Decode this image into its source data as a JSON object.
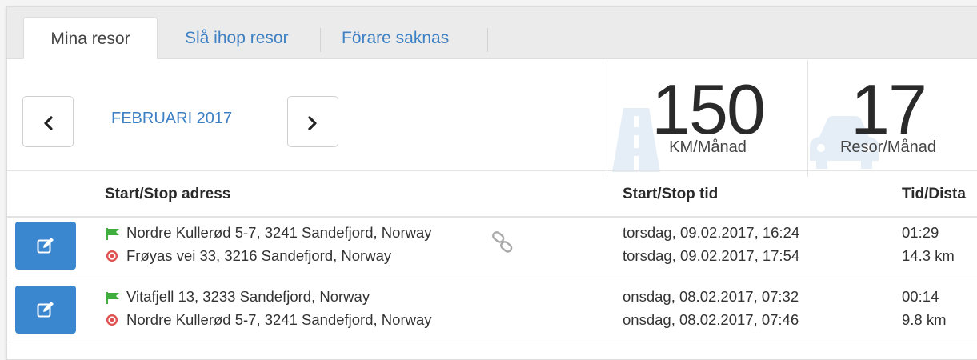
{
  "tabs": [
    {
      "label": "Mina resor",
      "active": true
    },
    {
      "label": "Slå ihop resor",
      "active": false
    },
    {
      "label": "Förare saknas",
      "active": false
    }
  ],
  "header": {
    "month_label": "FEBRUARI 2017",
    "prev_icon": "chevron-left-icon",
    "next_icon": "chevron-right-icon"
  },
  "stats": [
    {
      "value": "150",
      "unit": "KM/Månad",
      "icon": "road-icon"
    },
    {
      "value": "17",
      "unit": "Resor/Månad",
      "icon": "car-icon"
    }
  ],
  "table": {
    "columns": [
      "Start/Stop adress",
      "Start/Stop tid",
      "Tid/Dista"
    ],
    "rows": [
      {
        "start_address": "Nordre Kullerød 5-7, 3241 Sandefjord, Norway",
        "stop_address": "Frøyas vei 33, 3216 Sandefjord, Norway",
        "start_time": "torsdag, 09.02.2017, 16:24",
        "stop_time": "torsdag, 09.02.2017, 17:54",
        "duration": "01:29",
        "distance": "14.3 km",
        "linked": true
      },
      {
        "start_address": "Vitafjell 13, 3233 Sandefjord, Norway",
        "stop_address": "Nordre Kullerød 5-7, 3241 Sandefjord, Norway",
        "start_time": "onsdag, 08.02.2017, 07:32",
        "stop_time": "onsdag, 08.02.2017, 07:46",
        "duration": "00:14",
        "distance": "9.8 km",
        "linked": false
      }
    ]
  },
  "colors": {
    "accent": "#3d80c4",
    "edit_button": "#3a87cf",
    "start_flag": "#3fae3f",
    "stop_marker": "#e05050"
  }
}
